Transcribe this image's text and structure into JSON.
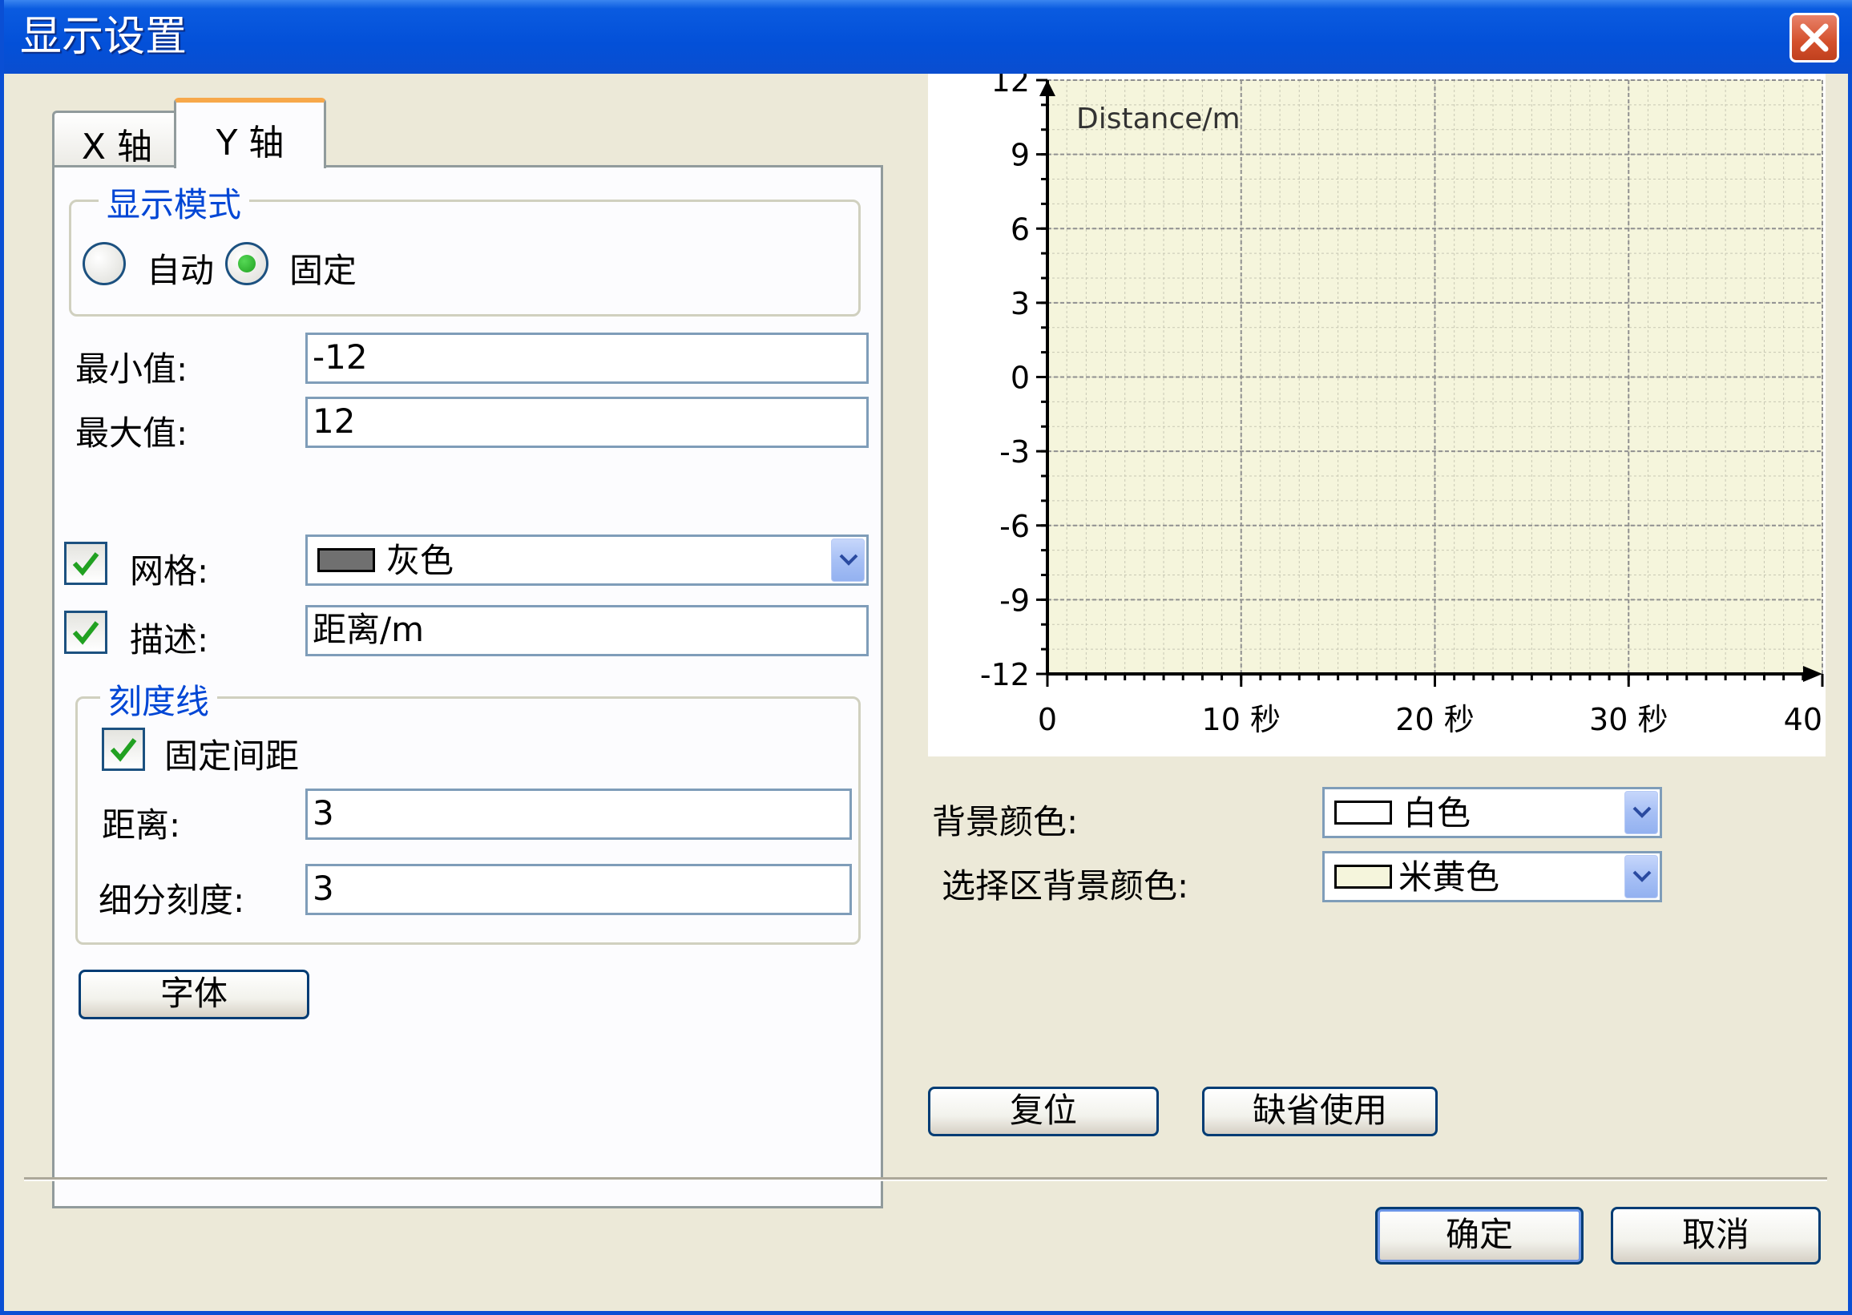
{
  "window": {
    "title": "显示设置"
  },
  "tabs": [
    {
      "label": "X 轴"
    },
    {
      "label": "Y 轴"
    }
  ],
  "display_mode": {
    "legend": "显示模式",
    "options": [
      {
        "label": "自动",
        "selected": false
      },
      {
        "label": "固定",
        "selected": true
      }
    ]
  },
  "fields": {
    "min_label": "最小值:",
    "min_value": "-12",
    "max_label": "最大值:",
    "max_value": "12",
    "grid_label": "网格:",
    "grid_checked": true,
    "grid_color": "灰色",
    "grid_swatch": "#707070",
    "desc_label": "描述:",
    "desc_checked": true,
    "desc_value": "距离/m"
  },
  "ticks": {
    "legend": "刻度线",
    "fixed_spacing_label": "固定间距",
    "fixed_spacing_checked": true,
    "distance_label": "距离:",
    "distance_value": "3",
    "subdiv_label": "细分刻度:",
    "subdiv_value": "3"
  },
  "font_button": "字体",
  "right": {
    "bg_color_label": "背景颜色:",
    "bg_color_value": "白色",
    "bg_swatch": "#ffffff",
    "sel_bg_label": "选择区背景颜色:",
    "sel_bg_value": "米黄色",
    "sel_swatch": "#f5f5dc"
  },
  "buttons": {
    "reset": "复位",
    "default": "缺省使用",
    "ok": "确定",
    "cancel": "取消"
  },
  "chart_data": {
    "type": "line",
    "ylabel": "Distance/m",
    "yticks": [
      "12",
      "9",
      "6",
      "3",
      "0",
      "-3",
      "-6",
      "-9",
      "-12"
    ],
    "xticks": [
      "0",
      "10 秒",
      "20 秒",
      "30 秒",
      "40"
    ],
    "ylim": [
      -12,
      12
    ],
    "xlim": [
      0,
      40
    ],
    "grid": true,
    "plot_bg": "#f5f5dc",
    "grid_color": "#909090",
    "series": []
  }
}
